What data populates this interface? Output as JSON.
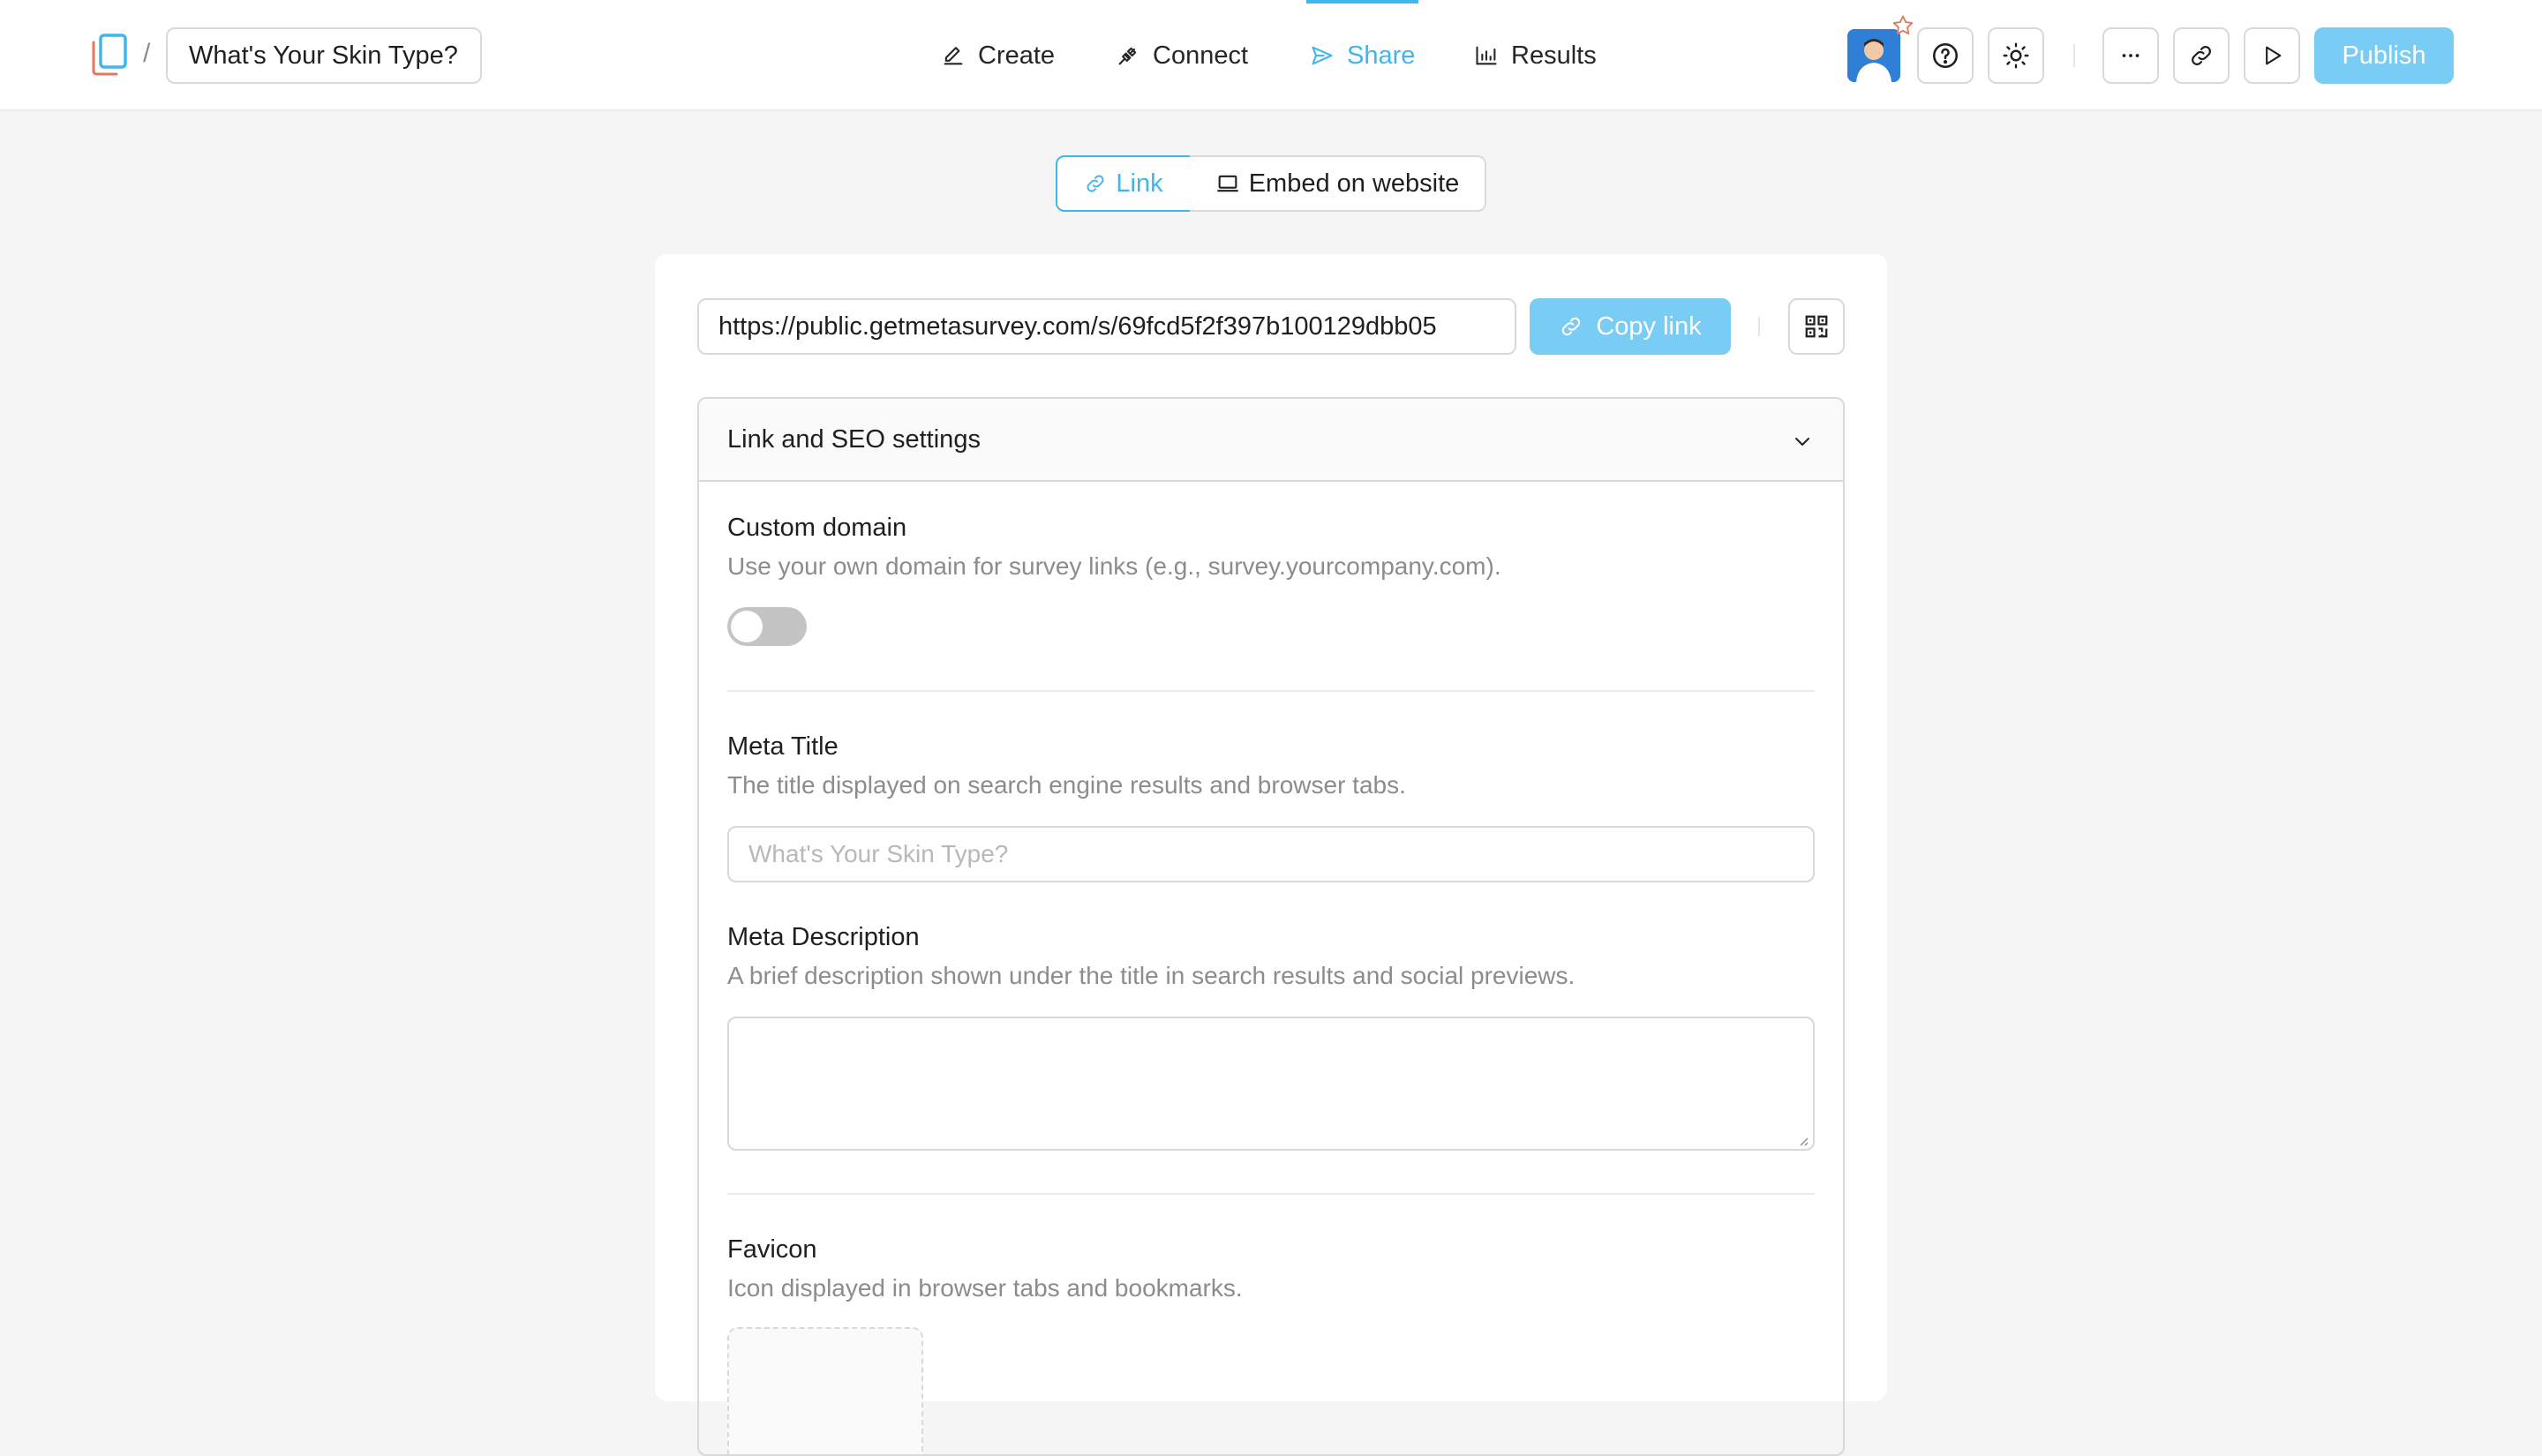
{
  "header": {
    "breadcrumb_separator": "/",
    "survey_title": "What's Your Skin Type?",
    "tabs": [
      {
        "label": "Create",
        "icon": "pencil-icon"
      },
      {
        "label": "Connect",
        "icon": "plug-icon"
      },
      {
        "label": "Share",
        "icon": "send-icon",
        "active": true
      },
      {
        "label": "Results",
        "icon": "bar-chart-icon"
      }
    ],
    "publish_label": "Publish"
  },
  "share_mode": {
    "link_label": "Link",
    "embed_label": "Embed on website",
    "selected": "Link"
  },
  "link_panel": {
    "url": "https://public.getmetasurvey.com/s/69fcd5f2f397b100129dbb05",
    "copy_label": "Copy link"
  },
  "seo_settings": {
    "title": "Link and SEO settings",
    "custom_domain": {
      "label": "Custom domain",
      "description": "Use your own domain for survey links (e.g., survey.yourcompany.com).",
      "enabled": false
    },
    "meta_title": {
      "label": "Meta Title",
      "description": "The title displayed on search engine results and browser tabs.",
      "placeholder": "What's Your Skin Type?"
    },
    "meta_description": {
      "label": "Meta Description",
      "description": "A brief description shown under the title in search results and social previews.",
      "value": ""
    },
    "favicon": {
      "label": "Favicon",
      "description": "Icon displayed in browser tabs and bookmarks."
    }
  },
  "colors": {
    "accent": "#3fb6ec",
    "accent_light": "#79ccf4",
    "border": "#d9d9d9",
    "page_bg": "#f5f5f5"
  }
}
